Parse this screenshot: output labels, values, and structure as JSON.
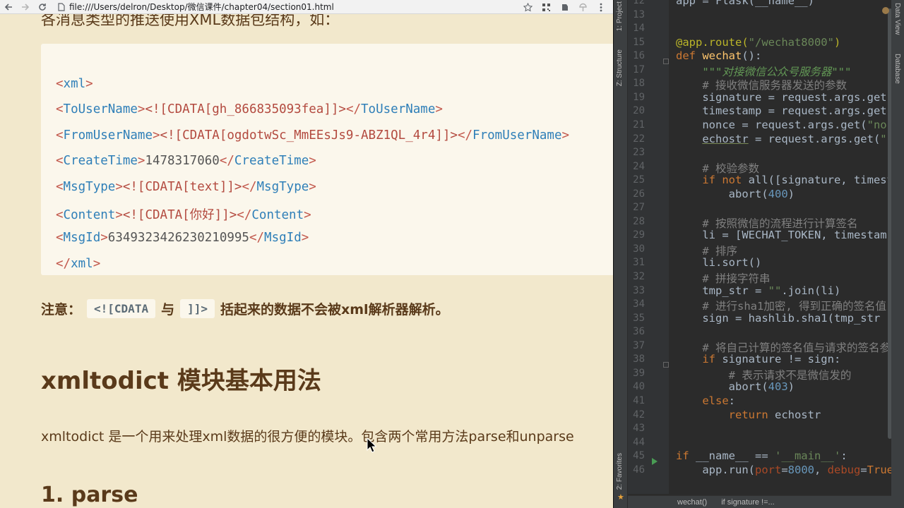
{
  "browser": {
    "url": "file:///Users/delron/Desktop/微信课件/chapter04/section01.html",
    "icons": [
      "back-arrow-icon",
      "forward-arrow-icon",
      "reload-icon",
      "file-icon",
      "star-icon",
      "qr-code-icon",
      "evernote-icon",
      "extension-icon",
      "menu-icon"
    ],
    "cut_heading": "各消息类型的推送使用XML数据包结构，如：",
    "xml_lines": [
      {
        "parts": [
          [
            "br",
            "<"
          ],
          [
            "tag",
            "xml"
          ],
          [
            "br",
            ">"
          ]
        ]
      },
      {
        "parts": [
          [
            "br",
            "<"
          ],
          [
            "tag",
            "ToUserName"
          ],
          [
            "br",
            ">"
          ],
          [
            "cdata",
            "<![CDATA[gh_866835093fea]]>"
          ],
          [
            "br",
            "</"
          ],
          [
            "tag",
            "ToUserName"
          ],
          [
            "br",
            ">"
          ]
        ]
      },
      {
        "parts": [
          [
            "br",
            "<"
          ],
          [
            "tag",
            "FromUserName"
          ],
          [
            "br",
            ">"
          ],
          [
            "cdata",
            "<![CDATA[ogdotwSc_MmEEsJs9-ABZ1QL_4r4]]>"
          ],
          [
            "br",
            "</"
          ],
          [
            "tag",
            "FromUserName"
          ],
          [
            "br",
            ">"
          ]
        ]
      },
      {
        "parts": [
          [
            "br",
            "<"
          ],
          [
            "tag",
            "CreateTime"
          ],
          [
            "br",
            ">"
          ],
          [
            "txt",
            "1478317060"
          ],
          [
            "br",
            "</"
          ],
          [
            "tag",
            "CreateTime"
          ],
          [
            "br",
            ">"
          ]
        ]
      },
      {
        "parts": [
          [
            "br",
            "<"
          ],
          [
            "tag",
            "MsgType"
          ],
          [
            "br",
            ">"
          ],
          [
            "cdata",
            "<![CDATA[text]]>"
          ],
          [
            "br",
            "</"
          ],
          [
            "tag",
            "MsgType"
          ],
          [
            "br",
            ">"
          ]
        ]
      },
      {
        "parts": [
          [
            "br",
            "<"
          ],
          [
            "tag",
            "Content"
          ],
          [
            "br",
            ">"
          ],
          [
            "cdata",
            "<![CDATA[你好]]>"
          ],
          [
            "br",
            "</"
          ],
          [
            "tag",
            "Content"
          ],
          [
            "br",
            ">"
          ]
        ]
      },
      {
        "parts": [
          [
            "br",
            "<"
          ],
          [
            "tag",
            "MsgId"
          ],
          [
            "br",
            ">"
          ],
          [
            "txt",
            "6349323426230210995"
          ],
          [
            "br",
            "</"
          ],
          [
            "tag",
            "MsgId"
          ],
          [
            "br",
            ">"
          ]
        ]
      },
      {
        "parts": [
          [
            "br",
            "</"
          ],
          [
            "tag",
            "xml"
          ],
          [
            "br",
            ">"
          ]
        ]
      }
    ],
    "note": {
      "prefix": "注意：",
      "code1": "<![CDATA",
      "mid": "与",
      "code2": "]]>",
      "suffix": "括起来的数据不会被xml解析器解析。"
    },
    "h2": "xmltodict 模块基本用法",
    "para": "xmltodict 是一个用来处理xml数据的很方便的模块。包含两个常用方法parse和unparse",
    "h3": "1. parse"
  },
  "ide": {
    "left_tabs": [
      "1: Project",
      "Z: Structure",
      "2: Favorites"
    ],
    "right_tabs": [
      "Data View",
      "Database"
    ],
    "lines": [
      {
        "n": "12",
        "parts": [
          [
            "p",
            "app = Flask(__name__)"
          ]
        ]
      },
      {
        "n": "13",
        "parts": []
      },
      {
        "n": "14",
        "parts": []
      },
      {
        "n": "15",
        "parts": [
          [
            "deco",
            "@app.route("
          ],
          [
            "str",
            "\"/wechat8000\""
          ],
          [
            "deco",
            ")"
          ]
        ]
      },
      {
        "n": "16",
        "parts": [
          [
            "kw",
            "def "
          ],
          [
            "fn",
            "wechat"
          ],
          [
            "p",
            "():"
          ]
        ]
      },
      {
        "n": "17",
        "parts": [
          [
            "p",
            "    "
          ],
          [
            "doc",
            "\"\"\"对接微信公众号服务器\"\"\""
          ]
        ]
      },
      {
        "n": "18",
        "parts": [
          [
            "p",
            "    "
          ],
          [
            "cm",
            "# 接收微信服务器发送的参数"
          ]
        ]
      },
      {
        "n": "19",
        "parts": [
          [
            "p",
            "    signature = request.args.get("
          ]
        ]
      },
      {
        "n": "20",
        "parts": [
          [
            "p",
            "    timestamp = request.args.get("
          ]
        ]
      },
      {
        "n": "21",
        "parts": [
          [
            "p",
            "    nonce = request.args.get("
          ],
          [
            "str",
            "\"nonce\""
          ]
        ]
      },
      {
        "n": "22",
        "parts": [
          [
            "p",
            "    "
          ],
          [
            "ul",
            "echostr"
          ],
          [
            "p",
            " = request.args.get("
          ],
          [
            "str",
            "\""
          ]
        ]
      },
      {
        "n": "23",
        "parts": []
      },
      {
        "n": "24",
        "parts": [
          [
            "p",
            "    "
          ],
          [
            "cm",
            "# 校验参数"
          ]
        ]
      },
      {
        "n": "25",
        "parts": [
          [
            "p",
            "    "
          ],
          [
            "kw",
            "if not "
          ],
          [
            "p",
            "all([signature, timestamp"
          ]
        ]
      },
      {
        "n": "26",
        "parts": [
          [
            "p",
            "        abort("
          ],
          [
            "num",
            "400"
          ],
          [
            "p",
            ")"
          ]
        ]
      },
      {
        "n": "27",
        "parts": []
      },
      {
        "n": "28",
        "parts": [
          [
            "p",
            "    "
          ],
          [
            "cm",
            "# 按照微信的流程进行计算签名"
          ]
        ]
      },
      {
        "n": "29",
        "parts": [
          [
            "p",
            "    li = [WECHAT_TOKEN, timestamp"
          ]
        ]
      },
      {
        "n": "30",
        "parts": [
          [
            "p",
            "    "
          ],
          [
            "cm",
            "# 排序"
          ]
        ]
      },
      {
        "n": "31",
        "parts": [
          [
            "p",
            "    li.sort()"
          ]
        ]
      },
      {
        "n": "32",
        "parts": [
          [
            "p",
            "    "
          ],
          [
            "cm",
            "# 拼接字符串"
          ]
        ]
      },
      {
        "n": "33",
        "parts": [
          [
            "p",
            "    tmp_str = "
          ],
          [
            "str",
            "\"\""
          ],
          [
            "p",
            ".join(li)"
          ]
        ]
      },
      {
        "n": "34",
        "parts": [
          [
            "p",
            "    "
          ],
          [
            "cm",
            "# 进行sha1加密, 得到正确的签名值"
          ]
        ]
      },
      {
        "n": "35",
        "parts": [
          [
            "p",
            "    sign = hashlib.sha1(tmp_str"
          ]
        ]
      },
      {
        "n": "36",
        "parts": []
      },
      {
        "n": "37",
        "parts": [
          [
            "p",
            "    "
          ],
          [
            "cm",
            "# 将自己计算的签名值与请求的签名参数"
          ]
        ]
      },
      {
        "n": "38",
        "parts": [
          [
            "p",
            "    "
          ],
          [
            "kw",
            "if "
          ],
          [
            "p",
            "signature != sign:"
          ]
        ]
      },
      {
        "n": "39",
        "parts": [
          [
            "p",
            "        "
          ],
          [
            "cm",
            "# 表示请求不是微信发的"
          ]
        ]
      },
      {
        "n": "40",
        "parts": [
          [
            "p",
            "        abort("
          ],
          [
            "num",
            "403"
          ],
          [
            "p",
            ")"
          ]
        ]
      },
      {
        "n": "41",
        "parts": [
          [
            "p",
            "    "
          ],
          [
            "kw",
            "else"
          ],
          [
            "p",
            ":"
          ]
        ]
      },
      {
        "n": "42",
        "parts": [
          [
            "p",
            "        "
          ],
          [
            "kw",
            "return "
          ],
          [
            "p",
            "echostr"
          ]
        ]
      },
      {
        "n": "43",
        "parts": []
      },
      {
        "n": "44",
        "parts": []
      },
      {
        "n": "45",
        "parts": [
          [
            "kw",
            "if "
          ],
          [
            "p",
            "__name__ == "
          ],
          [
            "str",
            "'__main__'"
          ],
          [
            "p",
            ":"
          ]
        ]
      },
      {
        "n": "46",
        "parts": [
          [
            "p",
            "    app.run("
          ],
          [
            "kwarg",
            "port"
          ],
          [
            "p",
            "="
          ],
          [
            "num",
            "8000"
          ],
          [
            "p",
            ", "
          ],
          [
            "kwarg",
            "debug"
          ],
          [
            "p",
            "="
          ],
          [
            "kw",
            "True"
          ],
          [
            "p",
            ")"
          ]
        ]
      }
    ],
    "breadcrumb": [
      "wechat()",
      "if signature !=..."
    ]
  }
}
